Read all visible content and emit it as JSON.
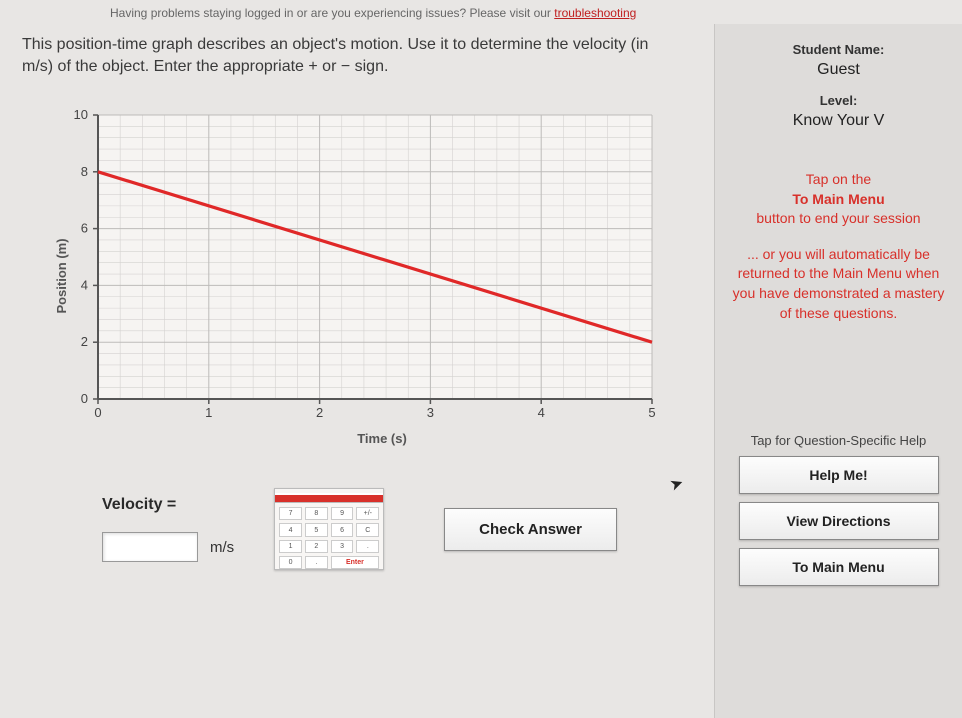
{
  "top_note_prefix": "Having problems staying logged in or are you experiencing issues? Please visit our ",
  "top_note_link": "troubleshooting",
  "question": "This position-time graph describes an object's motion. Use it to determine the velocity (in m/s) of the object. Enter the appropriate + or − sign.",
  "answer": {
    "label": "Velocity =",
    "unit": "m/s",
    "value": ""
  },
  "check_label": "Check Answer",
  "sidebar": {
    "name_label": "Student Name:",
    "name_value": "Guest",
    "level_label": "Level:",
    "level_value": "Know Your V",
    "hint_line1": "Tap on the",
    "hint_bold": "To Main Menu",
    "hint_line2": "button to end your session",
    "hint2": "... or you will automatically be returned to the Main Menu when you have demonstrated a mastery of these questions.",
    "help_label": "Tap for Question-Specific Help",
    "help_btn": "Help Me!",
    "directions_btn": "View Directions",
    "menu_btn": "To Main Menu"
  },
  "chart_data": {
    "type": "line",
    "title": "",
    "xlabel": "Time (s)",
    "ylabel": "Position (m)",
    "xlim": [
      0,
      5
    ],
    "ylim": [
      0,
      10
    ],
    "xticks": [
      0,
      1,
      2,
      3,
      4,
      5
    ],
    "yticks": [
      0,
      2,
      4,
      6,
      8,
      10
    ],
    "minor_grid_divisions": 5,
    "series": [
      {
        "name": "position",
        "color": "#e02828",
        "x": [
          0,
          5
        ],
        "y": [
          8,
          2
        ]
      }
    ]
  }
}
